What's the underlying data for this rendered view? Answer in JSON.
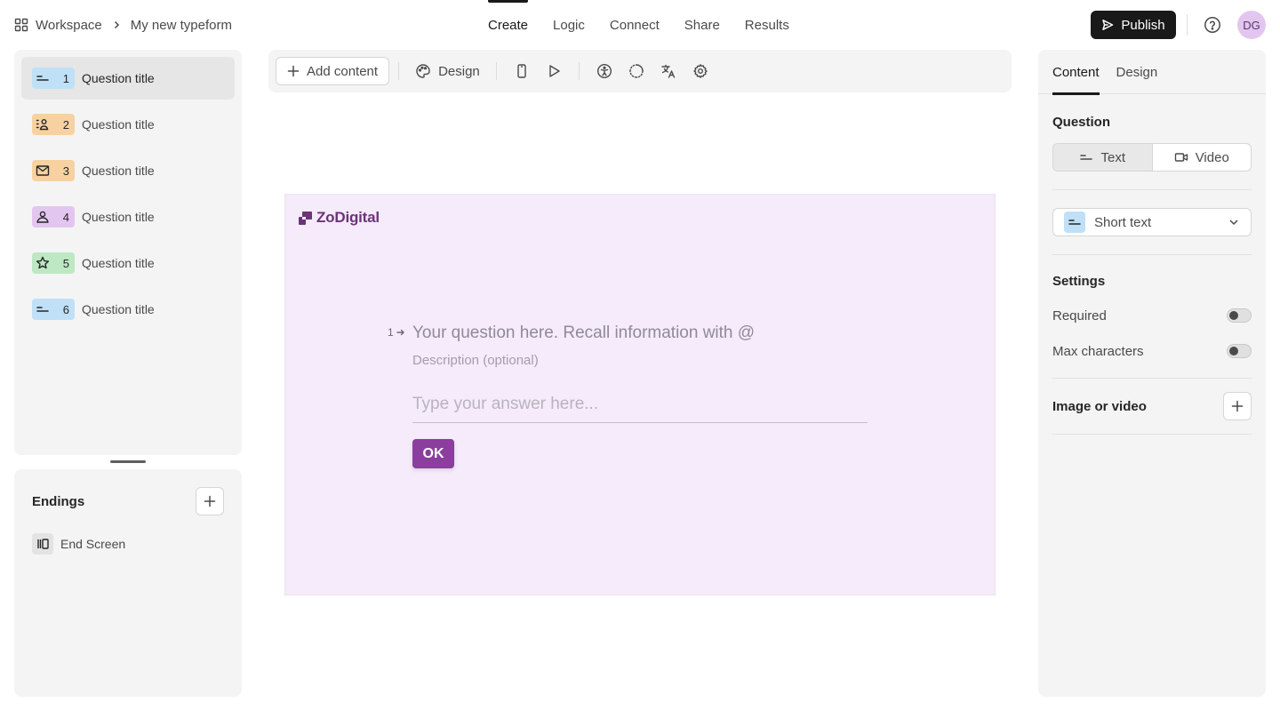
{
  "breadcrumb": {
    "workspace": "Workspace",
    "form_name": "My new typeform"
  },
  "nav_tabs": [
    {
      "label": "Create",
      "active": true
    },
    {
      "label": "Logic"
    },
    {
      "label": "Connect"
    },
    {
      "label": "Share"
    },
    {
      "label": "Results"
    }
  ],
  "header": {
    "publish_label": "Publish",
    "avatar_initials": "DG"
  },
  "questions": [
    {
      "number": "1",
      "label": "Question title",
      "icon": "short-text-icon",
      "color": "#bfe0f6",
      "selected": true
    },
    {
      "number": "2",
      "label": "Question title",
      "icon": "contact-info-icon",
      "color": "#f7d2a0"
    },
    {
      "number": "3",
      "label": "Question title",
      "icon": "email-icon",
      "color": "#f7d2a0"
    },
    {
      "number": "4",
      "label": "Question title",
      "icon": "person-icon",
      "color": "#e3c6ef"
    },
    {
      "number": "5",
      "label": "Question title",
      "icon": "star-icon",
      "color": "#bde8c3"
    },
    {
      "number": "6",
      "label": "Question title",
      "icon": "short-text-icon",
      "color": "#bfe0f6"
    }
  ],
  "endings": {
    "title": "Endings",
    "items": [
      {
        "label": "End Screen",
        "icon": "end-screen-icon"
      }
    ]
  },
  "toolbar": {
    "add_content_label": "Add content",
    "design_label": "Design",
    "icons": [
      "mobile-preview-icon",
      "play-icon",
      "accessibility-icon",
      "loading-icon",
      "translate-icon",
      "settings-icon"
    ]
  },
  "preview": {
    "brand_name": "ZoDigital",
    "question_number": "1",
    "question_placeholder": "Your question here. Recall information with @",
    "description_placeholder": "Description (optional)",
    "answer_placeholder": "Type your answer here...",
    "ok_label": "OK",
    "background_color": "#f5ebfb",
    "button_color": "#8b3e9d"
  },
  "right_panel": {
    "tabs": [
      {
        "label": "Content",
        "active": true
      },
      {
        "label": "Design"
      }
    ],
    "question_section": "Question",
    "question_format": {
      "options": [
        "Text",
        "Video"
      ],
      "selected": "Text"
    },
    "question_type": "Short text",
    "settings_title": "Settings",
    "settings": [
      {
        "label": "Required",
        "enabled": false
      },
      {
        "label": "Max characters",
        "enabled": false
      }
    ],
    "image_or_video_label": "Image or video"
  }
}
